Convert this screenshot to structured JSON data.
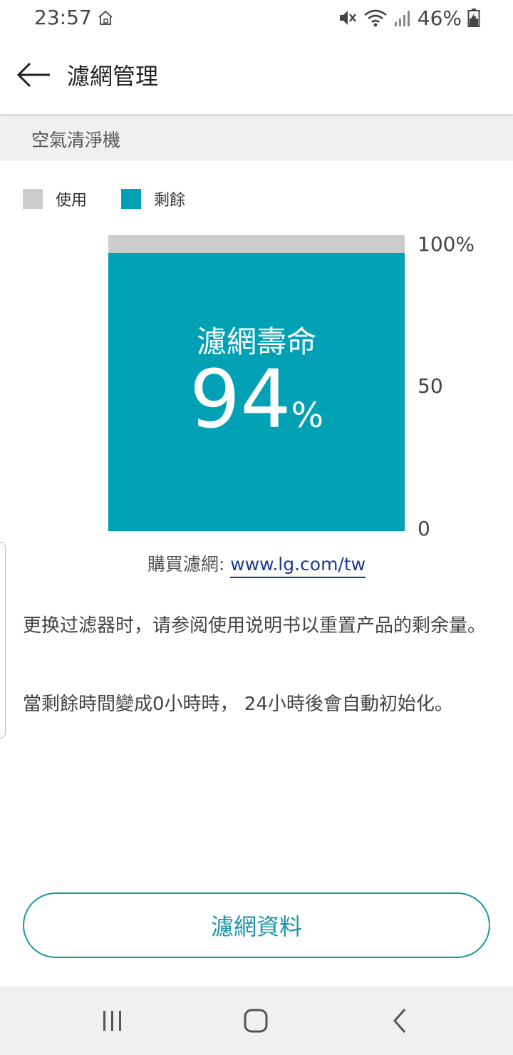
{
  "status_bar": {
    "time": "23:57",
    "battery": "46%",
    "icons": [
      "home-icon",
      "mute-icon",
      "wifi-icon",
      "signal-icon",
      "battery-charging-icon"
    ]
  },
  "app_bar": {
    "title": "濾網管理",
    "back_icon": "arrow-left-icon"
  },
  "section": {
    "title": "空氣清淨機"
  },
  "legend": {
    "used_label": "使用",
    "remaining_label": "剩餘"
  },
  "colors": {
    "used": "#cccccc",
    "remaining": "#00a0b5",
    "accent": "#1a95a8",
    "link": "#1a3a8f"
  },
  "chart_data": {
    "type": "bar",
    "title": "濾網壽命",
    "categories": [
      ""
    ],
    "series": [
      {
        "name": "使用",
        "values": [
          6
        ]
      },
      {
        "name": "剩餘",
        "values": [
          94
        ]
      }
    ],
    "value_text": "94",
    "value_unit": "%",
    "ylim": [
      0,
      100
    ],
    "yticks": [
      "100%",
      "50",
      "0"
    ],
    "stacked": true,
    "legend_position": "top-left"
  },
  "purchase": {
    "label": "購買濾網:",
    "link_text": "www.lg.com/tw"
  },
  "notes": {
    "reset_note": "更换过滤器时，请参阅使用说明书以重置产品的剩余量。",
    "auto_reset_note": "當剩餘時間變成0小時時， 24小時後會自動初始化。"
  },
  "buttons": {
    "filter_info": "濾網資料"
  },
  "nav_bar": {
    "recents_icon": "recents-icon",
    "home_icon": "home-button-icon",
    "back_icon": "back-chevron-icon"
  }
}
